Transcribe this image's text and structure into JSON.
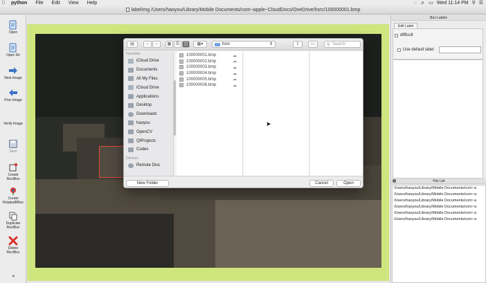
{
  "menubar": {
    "apple": "",
    "app_name": "python",
    "items": [
      "File",
      "Edit",
      "View",
      "Help"
    ],
    "clock": "Wed 11:14 PM"
  },
  "window": {
    "title": "labelImg /Users/haoyou/Library/Mobile Documents/com~apple~CloudDocs/OneDrive/hsrc/100000001.bmp"
  },
  "toolbar": {
    "open": "Open",
    "open_dir": "Open Dir",
    "next_image": "Next Image",
    "prev_image": "Prev Image",
    "verify_image": "Verify Image",
    "save": "Save",
    "create_rectbox": "Create\nRectBox",
    "create_rotatedrbox": "Create\nRotatedRBox",
    "duplicate_rectbox": "Duplicate\nRectBox",
    "delete_rectbox": "Delete\nRectBox",
    "more": "»"
  },
  "right_panel": {
    "box_labels_title": "Box Labels",
    "edit_tab": "Edit Label",
    "difficult": "difficult",
    "use_default_label": "Use default label",
    "default_label_value": "",
    "file_list_title": "File List",
    "file_list": [
      "/Users/haoyou/Library/Mobile Documents/com~a",
      "/Users/haoyou/Library/Mobile Documents/com~a",
      "/Users/haoyou/Library/Mobile Documents/com~a",
      "/Users/haoyou/Library/Mobile Documents/com~a",
      "/Users/haoyou/Library/Mobile Documents/com~a",
      "/Users/haoyou/Library/Mobile Documents/com~a"
    ]
  },
  "dialog": {
    "path": "hsrc",
    "search_placeholder": "Search",
    "favorites_heading": "Favorites",
    "devices_heading": "Devices",
    "favorites": [
      {
        "label": "iCloud Drive",
        "icon": "cloud-icon"
      },
      {
        "label": "Documents",
        "icon": "folder-icon"
      },
      {
        "label": "All My Files",
        "icon": "files-icon"
      },
      {
        "label": "iCloud Drive",
        "icon": "cloud-icon"
      },
      {
        "label": "Applications",
        "icon": "applications-icon"
      },
      {
        "label": "Desktop",
        "icon": "desktop-icon"
      },
      {
        "label": "Downloads",
        "icon": "downloads-icon"
      },
      {
        "label": "haoyou",
        "icon": "home-icon"
      },
      {
        "label": "OpenCV",
        "icon": "folder-icon"
      },
      {
        "label": "QtProjects",
        "icon": "folder-icon"
      },
      {
        "label": "Codes",
        "icon": "folder-icon"
      }
    ],
    "devices": [
      {
        "label": "Remote Disc",
        "icon": "disc-icon"
      }
    ],
    "files": [
      "100000001.bmp",
      "100000002.bmp",
      "100000003.bmp",
      "100000004.bmp",
      "100000005.bmp",
      "100000006.bmp"
    ],
    "new_folder": "New Folder",
    "cancel": "Cancel",
    "open": "Open"
  }
}
